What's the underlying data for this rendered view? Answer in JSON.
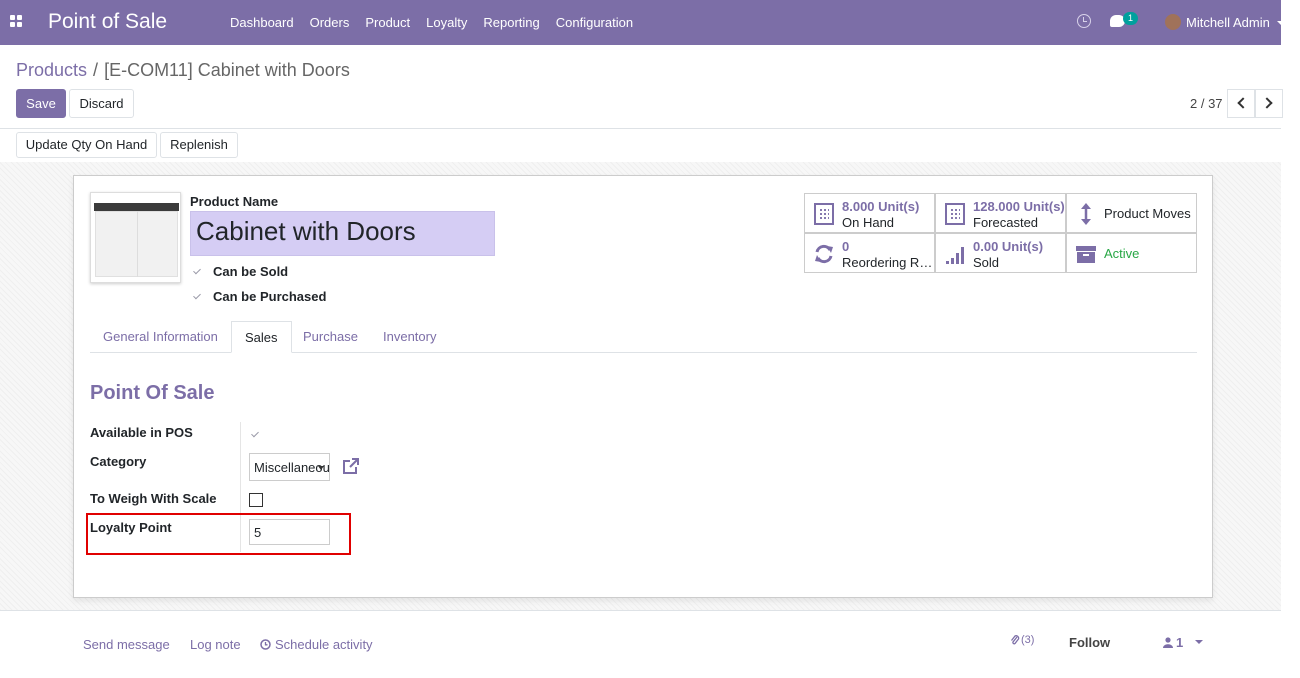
{
  "navbar": {
    "brand": "Point of Sale",
    "menu": [
      "Dashboard",
      "Orders",
      "Product",
      "Loyalty",
      "Reporting",
      "Configuration"
    ],
    "chat_count": "1",
    "user": "Mitchell Admin",
    "icons": {
      "apps": "apps-grid-icon",
      "activity": "clock-icon",
      "messages": "chat-icon"
    }
  },
  "breadcrumb": {
    "parent": "Products",
    "separator": "/",
    "current": "[E-COM11] Cabinet with Doors"
  },
  "actions": {
    "save": "Save",
    "discard": "Discard",
    "update_qty": "Update Qty On Hand",
    "replenish": "Replenish"
  },
  "pager": {
    "value": "2 / 37"
  },
  "product": {
    "name_label": "Product Name",
    "name": "Cabinet with Doors",
    "can_be_sold": "Can be Sold",
    "can_be_purchased": "Can be Purchased"
  },
  "smart_buttons": {
    "on_hand": {
      "value": "8.000 Unit(s)",
      "label": "On Hand"
    },
    "forecasted": {
      "value": "128.000 Unit(s)",
      "label": "Forecasted"
    },
    "moves": {
      "label": "Product Moves"
    },
    "reordering": {
      "value": "0",
      "label": "Reordering Rules"
    },
    "sold": {
      "value": "0.00 Unit(s)",
      "label": "Sold"
    },
    "active": {
      "label": "Active"
    }
  },
  "tabs": [
    "General Information",
    "Sales",
    "Purchase",
    "Inventory"
  ],
  "pos": {
    "title": "Point Of Sale",
    "available_label": "Available in POS",
    "category_label": "Category",
    "category_value": "Miscellaneous",
    "weigh_label": "To Weigh With Scale",
    "loyalty_label": "Loyalty Point",
    "loyalty_value": "5"
  },
  "chatter": {
    "send_message": "Send message",
    "log_note": "Log note",
    "schedule": "Schedule activity",
    "attachments": "(3)",
    "follow": "Follow",
    "followers": "1"
  },
  "colors": {
    "primary": "#7c6ea7",
    "active_green": "#28a745",
    "highlight": "#e00000"
  }
}
